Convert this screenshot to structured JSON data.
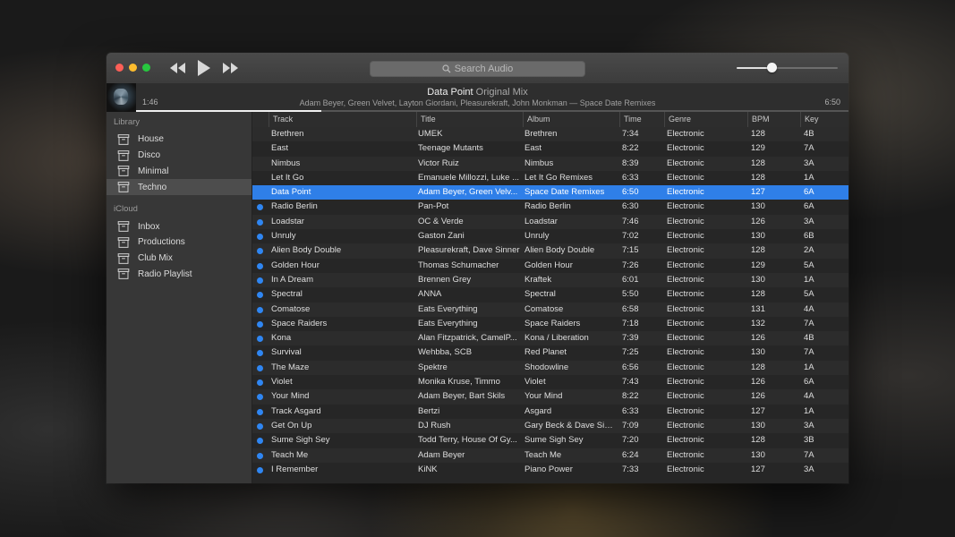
{
  "toolbar": {
    "search_placeholder": "Search Audio",
    "volume_percent": 0.35
  },
  "now_playing": {
    "title": "Data Point",
    "mix": "Original Mix",
    "artists_line": "Adam Beyer, Green Velvet, Layton Giordani, Pleasurekraft, John Monkman — Space Date Remixes",
    "elapsed": "1:46",
    "total": "6:50",
    "progress": 0.26
  },
  "sidebar": {
    "library_label": "Library",
    "library_items": [
      "House",
      "Disco",
      "Minimal",
      "Techno"
    ],
    "selected_library_item": "Techno",
    "icloud_label": "iCloud",
    "icloud_items": [
      "Inbox",
      "Productions",
      "Club Mix",
      "Radio Playlist"
    ]
  },
  "table": {
    "columns": [
      "Track",
      "Title",
      "Album",
      "Time",
      "Genre",
      "BPM",
      "Key"
    ],
    "rows": [
      {
        "track": "Brethren",
        "title": "UMEK",
        "album": "Brethren",
        "time": "7:34",
        "genre": "Electronic",
        "bpm": "128",
        "key": "4B",
        "dot": false,
        "active": false
      },
      {
        "track": "East",
        "title": "Teenage Mutants",
        "album": "East",
        "time": "8:22",
        "genre": "Electronic",
        "bpm": "129",
        "key": "7A",
        "dot": false,
        "active": false
      },
      {
        "track": "Nimbus",
        "title": "Victor Ruiz",
        "album": "Nimbus",
        "time": "8:39",
        "genre": "Electronic",
        "bpm": "128",
        "key": "3A",
        "dot": false,
        "active": false
      },
      {
        "track": "Let It Go",
        "title": "Emanuele Millozzi, Luke ...",
        "album": "Let It Go Remixes",
        "time": "6:33",
        "genre": "Electronic",
        "bpm": "128",
        "key": "1A",
        "dot": false,
        "active": false
      },
      {
        "track": "Data Point",
        "title": "Adam Beyer, Green Velv...",
        "album": "Space Date Remixes",
        "time": "6:50",
        "genre": "Electronic",
        "bpm": "127",
        "key": "6A",
        "dot": false,
        "active": true
      },
      {
        "track": "Radio Berlin",
        "title": "Pan-Pot",
        "album": "Radio Berlin",
        "time": "6:30",
        "genre": "Electronic",
        "bpm": "130",
        "key": "6A",
        "dot": true,
        "active": false
      },
      {
        "track": "Loadstar",
        "title": "OC & Verde",
        "album": "Loadstar",
        "time": "7:46",
        "genre": "Electronic",
        "bpm": "126",
        "key": "3A",
        "dot": true,
        "active": false
      },
      {
        "track": "Unruly",
        "title": "Gaston Zani",
        "album": "Unruly",
        "time": "7:02",
        "genre": "Electronic",
        "bpm": "130",
        "key": "6B",
        "dot": true,
        "active": false
      },
      {
        "track": "Alien Body Double",
        "title": "Pleasurekraft, Dave Sinner",
        "album": "Alien Body Double",
        "time": "7:15",
        "genre": "Electronic",
        "bpm": "128",
        "key": "2A",
        "dot": true,
        "active": false
      },
      {
        "track": "Golden Hour",
        "title": "Thomas Schumacher",
        "album": "Golden Hour",
        "time": "7:26",
        "genre": "Electronic",
        "bpm": "129",
        "key": "5A",
        "dot": true,
        "active": false
      },
      {
        "track": "In A Dream",
        "title": "Brennen Grey",
        "album": "Kraftek",
        "time": "6:01",
        "genre": "Electronic",
        "bpm": "130",
        "key": "1A",
        "dot": true,
        "active": false
      },
      {
        "track": "Spectral",
        "title": "ANNA",
        "album": "Spectral",
        "time": "5:50",
        "genre": "Electronic",
        "bpm": "128",
        "key": "5A",
        "dot": true,
        "active": false
      },
      {
        "track": "Comatose",
        "title": "Eats Everything",
        "album": "Comatose",
        "time": "6:58",
        "genre": "Electronic",
        "bpm": "131",
        "key": "4A",
        "dot": true,
        "active": false
      },
      {
        "track": "Space Raiders",
        "title": "Eats Everything",
        "album": "Space Raiders",
        "time": "7:18",
        "genre": "Electronic",
        "bpm": "132",
        "key": "7A",
        "dot": true,
        "active": false
      },
      {
        "track": "Kona",
        "title": "Alan Fitzpatrick, CamelP...",
        "album": "Kona / Liberation",
        "time": "7:39",
        "genre": "Electronic",
        "bpm": "126",
        "key": "4B",
        "dot": true,
        "active": false
      },
      {
        "track": "Survival",
        "title": "Wehbba, SCB",
        "album": "Red Planet",
        "time": "7:25",
        "genre": "Electronic",
        "bpm": "130",
        "key": "7A",
        "dot": true,
        "active": false
      },
      {
        "track": "The Maze",
        "title": "Spektre",
        "album": "Shodowline",
        "time": "6:56",
        "genre": "Electronic",
        "bpm": "128",
        "key": "1A",
        "dot": true,
        "active": false
      },
      {
        "track": "Violet",
        "title": "Monika Kruse, Timmo",
        "album": "Violet",
        "time": "7:43",
        "genre": "Electronic",
        "bpm": "126",
        "key": "6A",
        "dot": true,
        "active": false
      },
      {
        "track": "Your Mind",
        "title": "Adam Beyer, Bart Skils",
        "album": "Your Mind",
        "time": "8:22",
        "genre": "Electronic",
        "bpm": "126",
        "key": "4A",
        "dot": true,
        "active": false
      },
      {
        "track": "Track Asgard",
        "title": "Bertzi",
        "album": "Asgard",
        "time": "6:33",
        "genre": "Electronic",
        "bpm": "127",
        "key": "1A",
        "dot": true,
        "active": false
      },
      {
        "track": "Get On Up",
        "title": "DJ Rush",
        "album": "Gary Beck & Dave Sim...",
        "time": "7:09",
        "genre": "Electronic",
        "bpm": "130",
        "key": "3A",
        "dot": true,
        "active": false
      },
      {
        "track": "Sume Sigh Sey",
        "title": " Todd Terry, House Of Gy...",
        "album": "Sume Sigh  Sey",
        "time": "7:20",
        "genre": "Electronic",
        "bpm": "128",
        "key": "3B",
        "dot": true,
        "active": false
      },
      {
        "track": "Teach Me",
        "title": "Adam Beyer",
        "album": "Teach Me",
        "time": "6:24",
        "genre": "Electronic",
        "bpm": "130",
        "key": "7A",
        "dot": true,
        "active": false
      },
      {
        "track": "I Remember",
        "title": "KiNK",
        "album": "Piano Power",
        "time": "7:33",
        "genre": "Electronic",
        "bpm": "127",
        "key": "3A",
        "dot": true,
        "active": false
      }
    ]
  },
  "colors": {
    "accent": "#2f7fe8",
    "close": "#fc5f57",
    "minimize": "#fdbc2e",
    "maximize": "#27c83f"
  }
}
